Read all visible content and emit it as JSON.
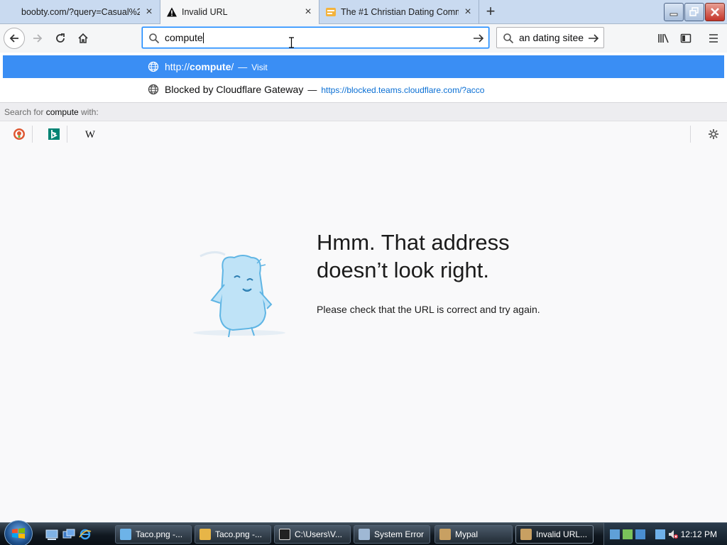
{
  "tabs": [
    {
      "title": "boobty.com/?query=Casual%2",
      "active": false
    },
    {
      "title": "Invalid URL",
      "active": true
    },
    {
      "title": "The #1 Christian Dating Comm",
      "active": false
    }
  ],
  "urlbar": {
    "value": "compute"
  },
  "searchbar": {
    "value": "an dating sitee"
  },
  "dropdown": {
    "row1": {
      "prefix": "http://",
      "bold": "compute",
      "suffix": "/",
      "sep": "—",
      "action": "Visit"
    },
    "row2": {
      "title": "Blocked by Cloudflare Gateway",
      "sep": "—",
      "url": "https://blocked.teams.cloudflare.com/?acco"
    },
    "search_with": {
      "prefix": "Search for ",
      "term": "compute",
      "suffix": " with:"
    }
  },
  "error": {
    "title_line1": "Hmm. That address",
    "title_line2": "doesn’t look right.",
    "description": "Please check that the URL is correct and try again."
  },
  "taskbar": {
    "tasks": [
      {
        "label": "Taco.png -..."
      },
      {
        "label": "Taco.png -..."
      },
      {
        "label": "C:\\Users\\V..."
      },
      {
        "label": "System Error"
      },
      {
        "label": "Mypal"
      },
      {
        "label": "Invalid URL..."
      }
    ],
    "clock": "12:12 PM"
  },
  "colors": {
    "accent": "#0a84ff",
    "selected_row": "#3a8ef4",
    "tabstrip": "#c9daf0",
    "close_button": "#c4352a"
  }
}
